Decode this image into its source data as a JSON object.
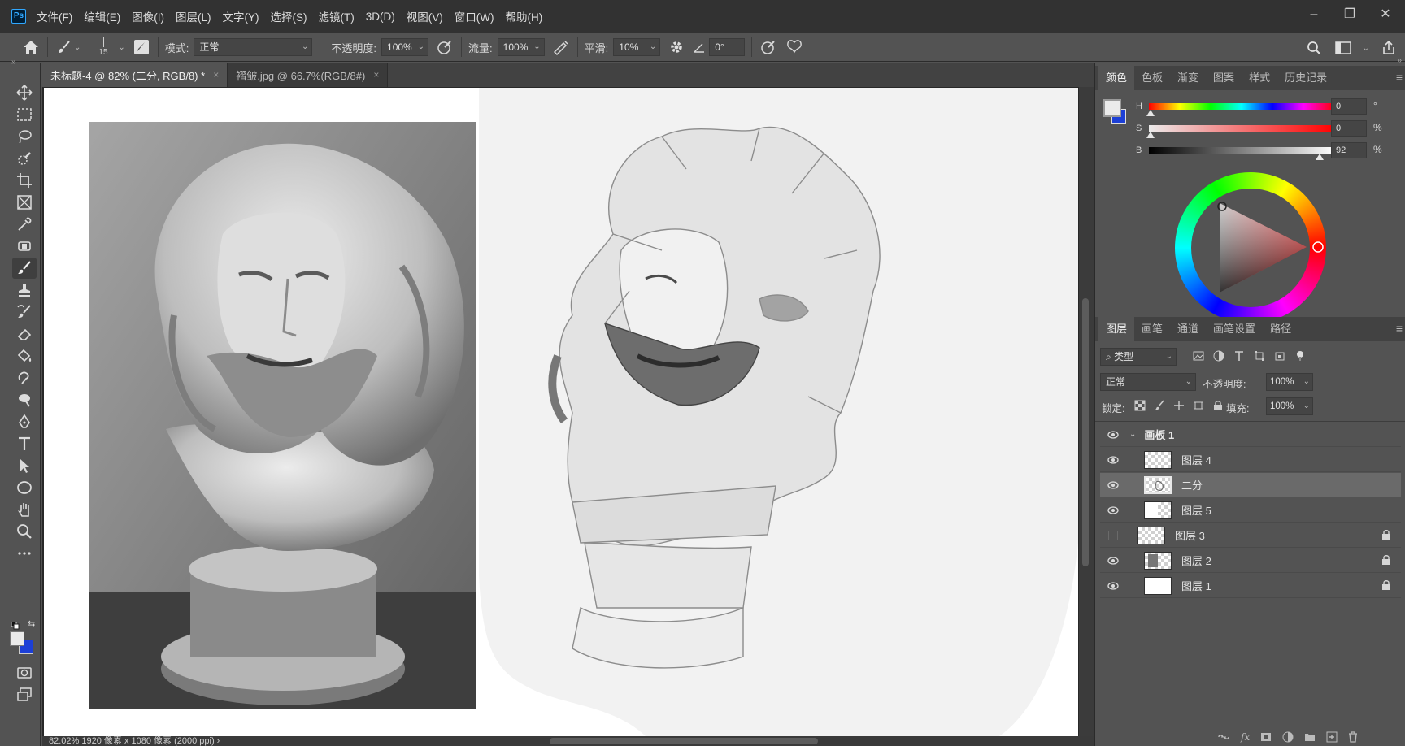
{
  "app": {
    "logo": "Ps"
  },
  "menu": [
    "文件(F)",
    "编辑(E)",
    "图像(I)",
    "图层(L)",
    "文字(Y)",
    "选择(S)",
    "滤镜(T)",
    "3D(D)",
    "视图(V)",
    "窗口(W)",
    "帮助(H)"
  ],
  "window_controls": {
    "minimize": "–",
    "restore": "❐",
    "close": "✕"
  },
  "options": {
    "brush_size": "15",
    "mode_label": "模式:",
    "mode_value": "正常",
    "opacity_label": "不透明度:",
    "opacity_value": "100%",
    "flow_label": "流量:",
    "flow_value": "100%",
    "smoothing_label": "平滑:",
    "smoothing_value": "10%",
    "angle_value": "0°"
  },
  "tabs": [
    {
      "label": "未标题-4 @ 82% (二分, RGB/8) *",
      "close": "×"
    },
    {
      "label": "褶皱.jpg @ 66.7%(RGB/8#)",
      "close": "×"
    }
  ],
  "status": {
    "text": "82.02%   1920 像素 x 1080 像素 (2000 ppi)  ›"
  },
  "color_panel": {
    "tabs": [
      "颜色",
      "色板",
      "渐变",
      "图案",
      "样式",
      "历史记录"
    ],
    "h_label": "H",
    "h_value": "0",
    "h_unit": "°",
    "s_label": "S",
    "s_value": "0",
    "s_unit": "%",
    "b_label": "B",
    "b_value": "92",
    "b_unit": "%",
    "foreground": "#ebebeb",
    "background": "#1c3fd6"
  },
  "layers_panel": {
    "tabs": [
      "图层",
      "画笔",
      "通道",
      "画笔设置",
      "路径"
    ],
    "filter_label": "类型",
    "blend_mode": "正常",
    "opacity_label": "不透明度:",
    "opacity_value": "100%",
    "lock_label": "锁定:",
    "fill_label": "填充:",
    "fill_value": "100%",
    "group_name": "画板 1",
    "layers": [
      {
        "name": "图层 4",
        "visible": true,
        "locked": false
      },
      {
        "name": "二分",
        "visible": true,
        "locked": false,
        "selected": true
      },
      {
        "name": "图层 5",
        "visible": true,
        "locked": false
      },
      {
        "name": "图层 3",
        "visible": false,
        "locked": true
      },
      {
        "name": "图层 2",
        "visible": true,
        "locked": true
      },
      {
        "name": "图层 1",
        "visible": true,
        "locked": true
      }
    ]
  }
}
